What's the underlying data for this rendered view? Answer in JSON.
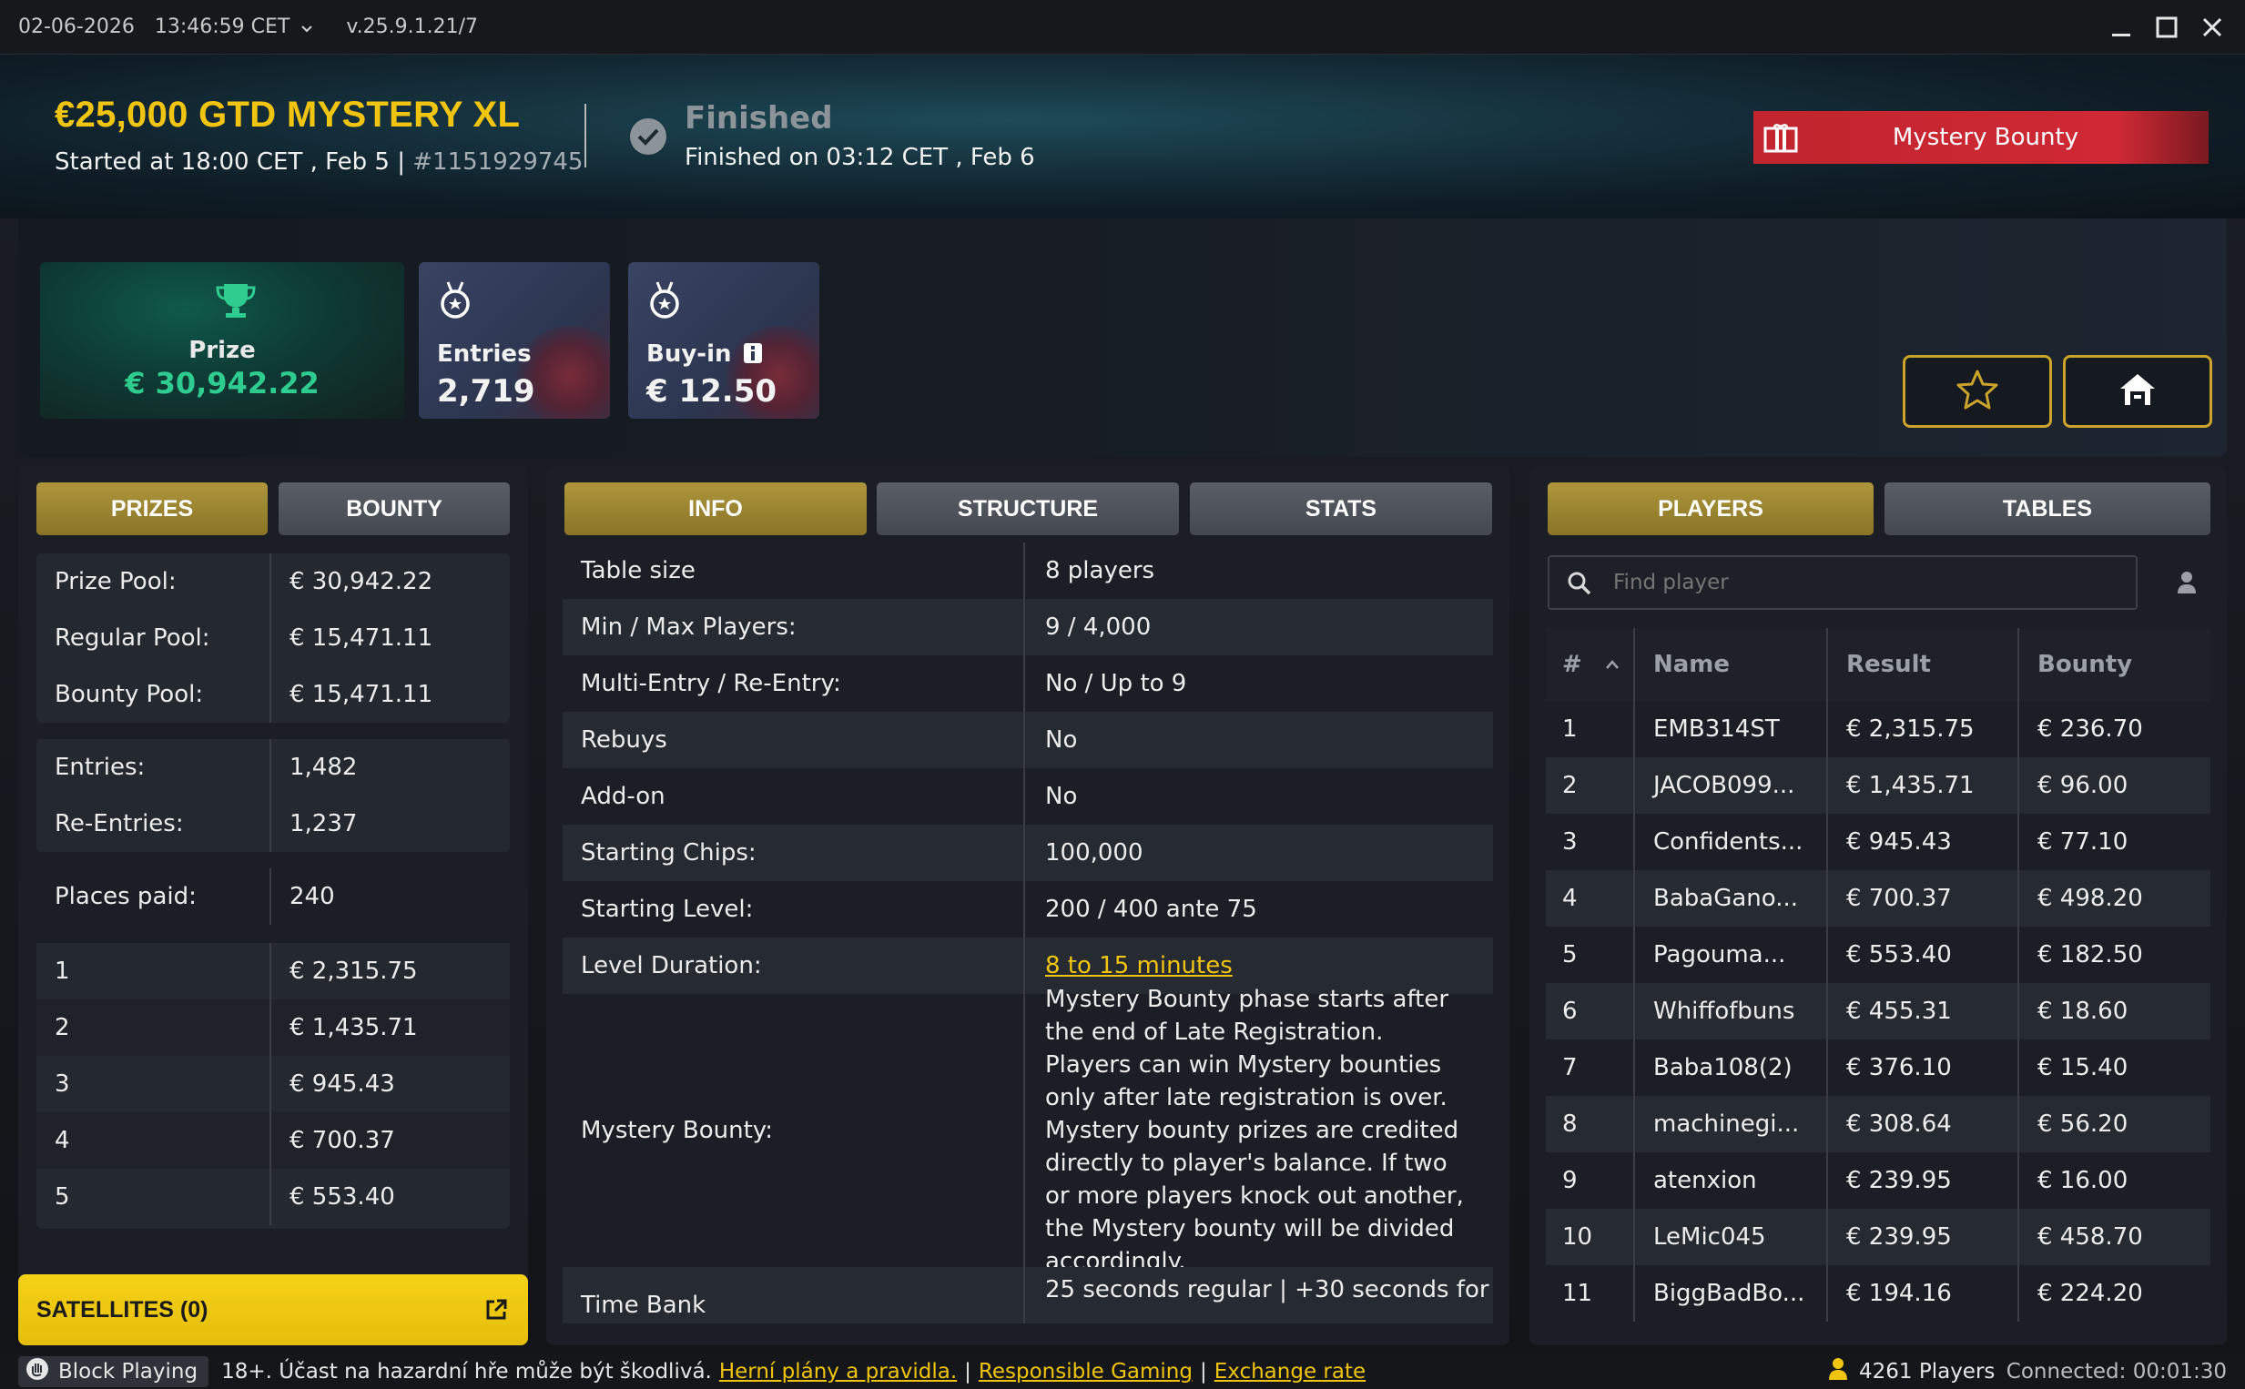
{
  "titlebar": {
    "date": "02-06-2026",
    "time": "13:46:59 CET",
    "version": "v.25.9.1.21/7"
  },
  "tournament": {
    "title": "€25,000 GTD MYSTERY XL",
    "started": "Started at 18:00 CET , Feb 5 |",
    "id": "#1151929745",
    "status": "Finished",
    "finished_on": "Finished on 03:12 CET , Feb 6",
    "badge": "Mystery Bounty"
  },
  "summary": {
    "prize_label": "Prize",
    "prize_value": "€ 30,942.22",
    "entries_label": "Entries",
    "entries_value": "2,719",
    "buyin_label": "Buy-in",
    "buyin_value": "€ 12.50"
  },
  "left_tabs": [
    "PRIZES",
    "BOUNTY"
  ],
  "pools": [
    {
      "k": "Prize Pool:",
      "v": "€ 30,942.22"
    },
    {
      "k": "Regular Pool:",
      "v": "€ 15,471.11"
    },
    {
      "k": "Bounty Pool:",
      "v": "€ 15,471.11"
    }
  ],
  "entries": [
    {
      "k": "Entries:",
      "v": "1,482"
    },
    {
      "k": "Re-Entries:",
      "v": "1,237"
    }
  ],
  "places_paid": {
    "k": "Places paid:",
    "v": "240"
  },
  "payouts": [
    {
      "k": "1",
      "v": "€ 2,315.75"
    },
    {
      "k": "2",
      "v": "€ 1,435.71"
    },
    {
      "k": "3",
      "v": "€ 945.43"
    },
    {
      "k": "4",
      "v": "€ 700.37"
    },
    {
      "k": "5",
      "v": "€ 553.40"
    }
  ],
  "center_tabs": [
    "INFO",
    "STRUCTURE",
    "STATS"
  ],
  "info": [
    {
      "k": "Table size",
      "v": "8 players"
    },
    {
      "k": "Min / Max Players:",
      "v": "9 / 4,000"
    },
    {
      "k": "Multi-Entry / Re-Entry:",
      "v": "No / Up to 9"
    },
    {
      "k": "Rebuys",
      "v": "No"
    },
    {
      "k": "Add-on",
      "v": "No"
    },
    {
      "k": "Starting Chips:",
      "v": "100,000"
    },
    {
      "k": "Starting Level:",
      "v": "200 / 400 ante 75"
    },
    {
      "k": "Level Duration:",
      "v": "8 to 15 minutes"
    },
    {
      "k": "Mystery Bounty:",
      "v": "Mystery Bounty phase starts after the end of Late Registration. Players can win Mystery bounties only after late registration is over. Mystery bounty prizes are credited directly to player's balance. If two or more players knock out another, the Mystery bounty will be divided accordingly."
    },
    {
      "k": "Time Bank",
      "v": "25 seconds regular | +30 seconds for"
    }
  ],
  "right_tabs": [
    "PLAYERS",
    "TABLES"
  ],
  "search": {
    "placeholder": "Find player"
  },
  "players_header": {
    "rank": "#",
    "name": "Name",
    "result": "Result",
    "bounty": "Bounty"
  },
  "players": [
    {
      "rank": "1",
      "name": "EMB314ST",
      "result": "€ 2,315.75",
      "bounty": "€ 236.70"
    },
    {
      "rank": "2",
      "name": "JACOB099...",
      "result": "€ 1,435.71",
      "bounty": "€ 96.00"
    },
    {
      "rank": "3",
      "name": "Confidents...",
      "result": "€ 945.43",
      "bounty": "€ 77.10"
    },
    {
      "rank": "4",
      "name": "BabaGano...",
      "result": "€ 700.37",
      "bounty": "€ 498.20"
    },
    {
      "rank": "5",
      "name": "Pagouma...",
      "result": "€ 553.40",
      "bounty": "€ 182.50"
    },
    {
      "rank": "6",
      "name": "Whiffofbuns",
      "result": "€ 455.31",
      "bounty": "€ 18.60"
    },
    {
      "rank": "7",
      "name": "Baba108(2)",
      "result": "€ 376.10",
      "bounty": "€ 15.40"
    },
    {
      "rank": "8",
      "name": "machinegi...",
      "result": "€ 308.64",
      "bounty": "€ 56.20"
    },
    {
      "rank": "9",
      "name": "atenxion",
      "result": "€ 239.95",
      "bounty": "€ 16.00"
    },
    {
      "rank": "10",
      "name": "LeMic045",
      "result": "€ 239.95",
      "bounty": "€ 458.70"
    },
    {
      "rank": "11",
      "name": "BiggBadBo...",
      "result": "€ 194.16",
      "bounty": "€ 224.20"
    }
  ],
  "satellites": "SATELLITES (0)",
  "footer": {
    "block": "Block Playing",
    "notice": "18+. Účast na hazardní hře může být škodlivá.",
    "link1": "Herní plány a pravidla.",
    "link2": "Responsible Gaming",
    "link3": "Exchange rate",
    "players": "4261 Players",
    "connected": "Connected: 00:01:30"
  },
  "colors": {
    "gold": "#f1c40f",
    "green": "#2ecc8f",
    "red": "#c1252f",
    "tab_active": "#ae963c"
  }
}
